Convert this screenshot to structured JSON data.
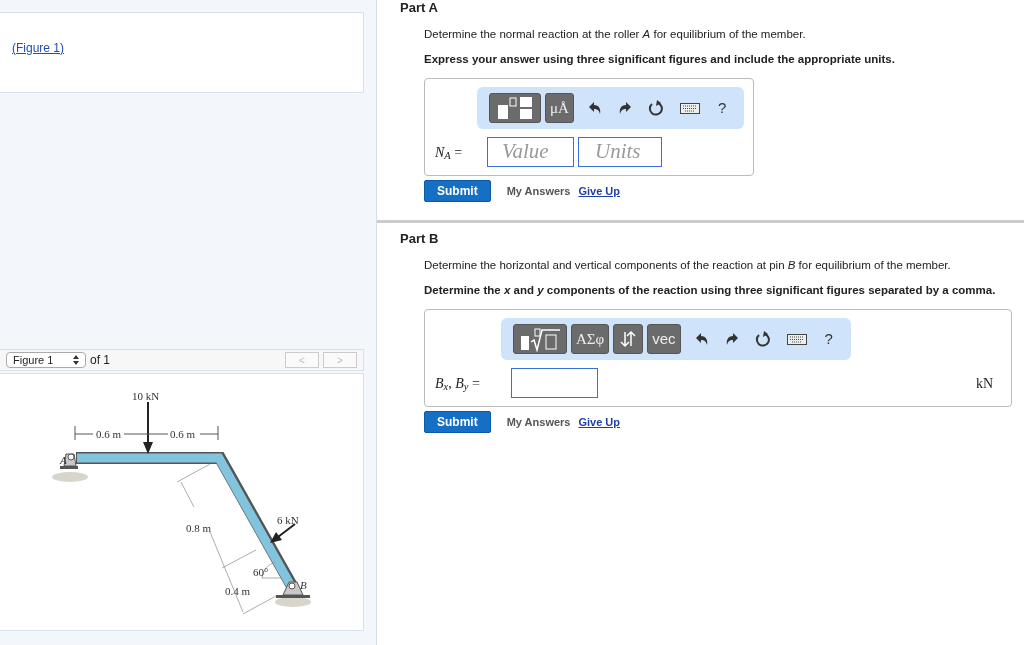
{
  "figure_link": "(Figure 1)",
  "figure_viewer": {
    "select": "Figure 1",
    "of_label": "of 1",
    "nav": [
      {
        "label": "<",
        "disabled": true
      },
      {
        "label": ">",
        "disabled": true
      }
    ],
    "labels": {
      "load_top": "10 kN",
      "dim_left": "0.6 m",
      "dim_right": "0.6 m",
      "point_a": "A",
      "dim_slant": "0.8 m",
      "load_side": "6 kN",
      "angle": "60°",
      "dim_low": "0.4 m",
      "point_b": "B"
    }
  },
  "parts": [
    {
      "title": "Part A",
      "prompt": "Determine the normal reaction at the roller *A* for equilibrium of the member.",
      "instruction": "Express your answer using three significant figures and include the appropriate units.",
      "toolbar": [
        {
          "kind": "fraction"
        },
        {
          "kind": "text",
          "label": "μÅ"
        },
        {
          "kind": "undo"
        },
        {
          "kind": "redo"
        },
        {
          "kind": "reset"
        },
        {
          "kind": "keyboard"
        },
        {
          "kind": "help",
          "label": "?"
        }
      ],
      "answer_label": "*N*$_{A}$ =",
      "fields": [
        {
          "kind": "value",
          "placeholder": "Value"
        },
        {
          "kind": "units",
          "placeholder": "Units"
        }
      ],
      "actions": {
        "submit": "Submit",
        "my_answers": "My Answers",
        "give_up": "Give Up"
      }
    },
    {
      "title": "Part B",
      "prompt": "Determine the horizontal and vertical components of the reaction at pin *B* for equilibrium of the member.",
      "instruction": "Determine the *x* and *y* components of the reaction using three significant figures separated by a comma.",
      "toolbar": [
        {
          "kind": "radical"
        },
        {
          "kind": "text",
          "label": "ΑΣφ"
        },
        {
          "kind": "swap"
        },
        {
          "kind": "text",
          "label": "vec"
        },
        {
          "kind": "undo"
        },
        {
          "kind": "redo"
        },
        {
          "kind": "reset"
        },
        {
          "kind": "keyboard"
        },
        {
          "kind": "help",
          "label": "?"
        }
      ],
      "answer_label": "*B*$_{x}$, *B*$_{y}$ =",
      "fields": [
        {
          "kind": "value"
        }
      ],
      "unit": "kN",
      "actions": {
        "submit": "Submit",
        "my_answers": "My Answers",
        "give_up": "Give Up"
      }
    }
  ]
}
